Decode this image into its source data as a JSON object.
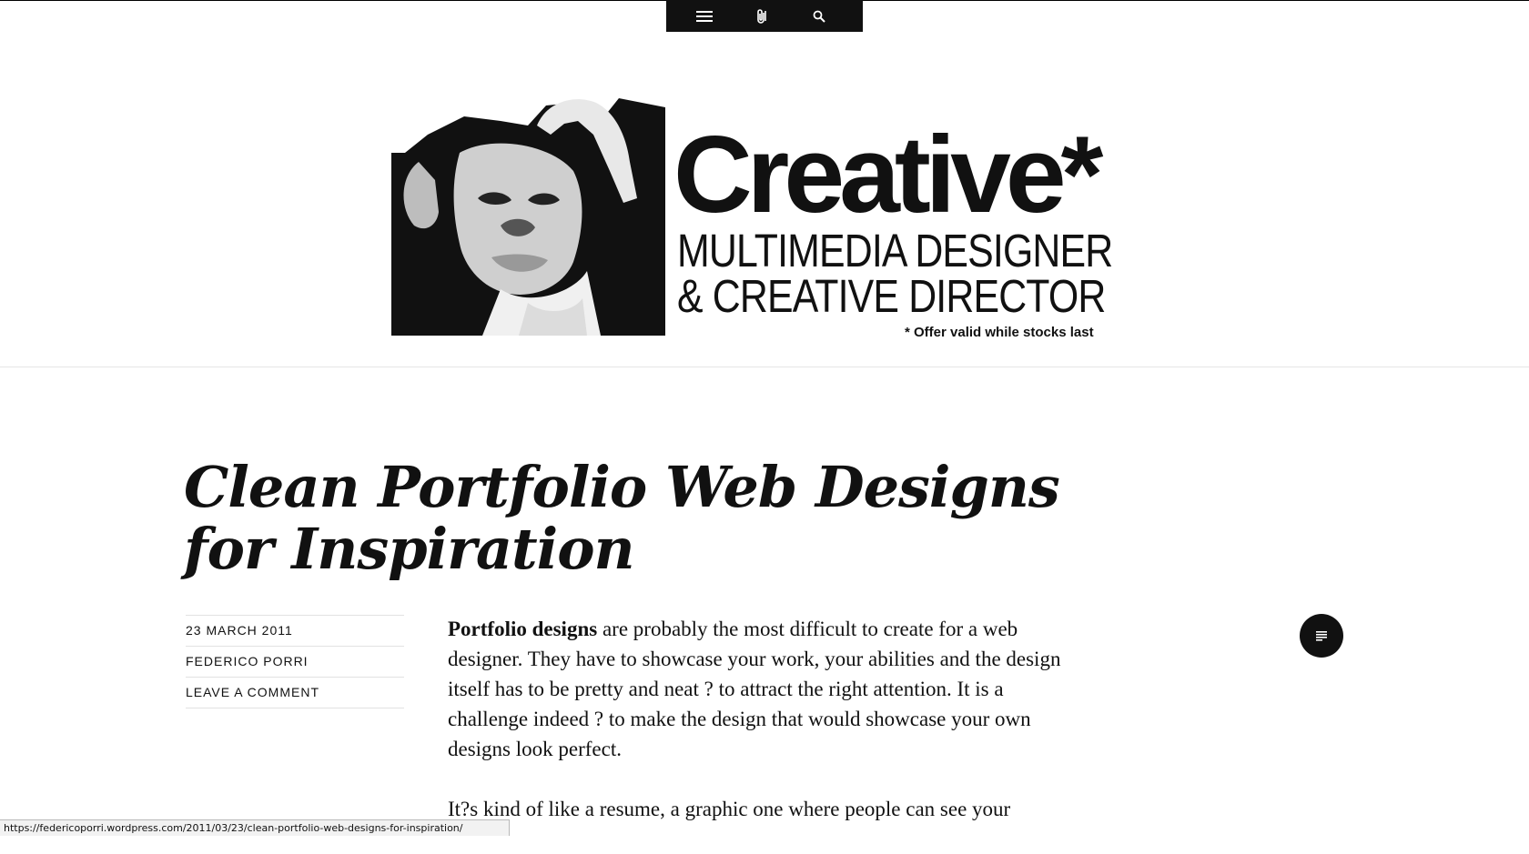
{
  "toolbar": {
    "icons": [
      "menu-icon",
      "paperclip-icon",
      "search-icon"
    ]
  },
  "header": {
    "brand_title": "Creative*",
    "brand_line_1": "MULTIMEDIA DESIGNER",
    "brand_line_2": "& CREATIVE DIRECTOR",
    "brand_note": "* Offer valid while stocks last"
  },
  "post": {
    "title_line_1": "Clean Portfolio Web Designs",
    "title_line_2": "for Inspiration",
    "meta": {
      "date": "23 March 2011",
      "author": "Federico Porri",
      "comment_link": "Leave a comment"
    },
    "paragraph_1_bold": "Portfolio designs",
    "paragraph_1_rest": " are probably the most difficult to create for a web designer. They have to showcase your work, your abilities and the design itself has to be pretty and neat ? to attract the right attention. It is a challenge indeed ? to make the design that would showcase your own designs look perfect.",
    "paragraph_2": "It?s kind of like a resume, a graphic one where people can see your"
  },
  "format_icon": "document-lines-icon",
  "status_bar": {
    "url": "https://federicoporri.wordpress.com/2011/03/23/clean-portfolio-web-designs-for-inspiration/"
  }
}
